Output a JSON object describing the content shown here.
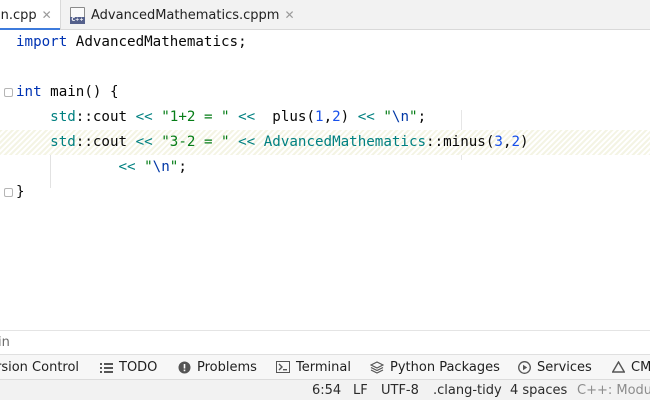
{
  "tabs": [
    {
      "label": "in.cpp",
      "close": "✕"
    },
    {
      "label": "AdvancedMathematics.cppm",
      "close": "✕"
    }
  ],
  "file_icon_badge": "C++",
  "code": {
    "l1": {
      "kw": "import",
      "rest": " AdvancedMathematics;"
    },
    "l3": {
      "kw": "int",
      "rest": " main() {"
    },
    "l4": {
      "indent": "    ",
      "ns": "std",
      "sep": "::",
      "fn": "cout",
      "op1": " << ",
      "s1": "\"1+2 = \"",
      "op2": " <<  ",
      "call": "plus(",
      "n1": "1",
      "comma": ",",
      "n2": "2",
      "close": ")",
      "op3": " << ",
      "q1": "\"",
      "esc": "\\n",
      "q2": "\"",
      "semi": ";"
    },
    "l5": {
      "indent": "    ",
      "ns": "std",
      "sep": "::",
      "fn": "cout",
      "op1": " << ",
      "s1": "\"3-2 = \"",
      "op2": " << ",
      "mod": "AdvancedMathematics",
      "sep2": "::",
      "call": "minus(",
      "n1": "3",
      "comma": ",",
      "n2": "2",
      "close": ")"
    },
    "l6": {
      "indent": "            ",
      "op": "<< ",
      "q1": "\"",
      "esc": "\\n",
      "q2": "\"",
      "semi": ";"
    },
    "l7": {
      "brace": "}"
    }
  },
  "breadcrumb": "in",
  "tool_windows": [
    {
      "label": "rsion Control",
      "icon": "version-control-icon"
    },
    {
      "label": "TODO",
      "icon": "list-icon"
    },
    {
      "label": "Problems",
      "icon": "info-icon"
    },
    {
      "label": "Terminal",
      "icon": "terminal-icon"
    },
    {
      "label": "Python Packages",
      "icon": "layers-icon"
    },
    {
      "label": "Services",
      "icon": "play-icon"
    },
    {
      "label": "CM",
      "icon": "warning-icon"
    }
  ],
  "status": {
    "position": "6:54",
    "line_sep": "LF",
    "encoding": "UTF-8",
    "linter": ".clang-tidy",
    "indent": "4 spaces",
    "context": "C++: Module"
  }
}
